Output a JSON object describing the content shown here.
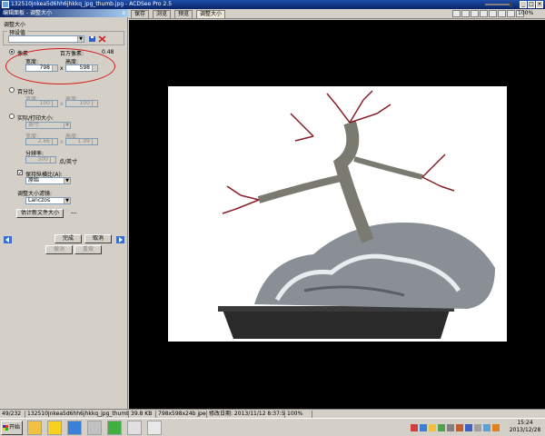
{
  "window": {
    "title": "132510jnkea5d6hh6jhkkq_jpg_thumb.jpg - ACDSee Pro 2.5"
  },
  "panel": {
    "header": "编辑面板 - 调整大小",
    "close_label": "x",
    "section_title": "调整大小",
    "preset": {
      "legend": "预设值",
      "value": ""
    },
    "pixels": {
      "radio_label": "像素",
      "megapixel_label": "百万像素:",
      "megapixel_value": "0.48",
      "width_label": "宽度:",
      "width_value": "798",
      "height_label": "高度:",
      "height_value": "598",
      "times": "x"
    },
    "percent": {
      "radio_label": "百分比",
      "width_label": "宽度:",
      "width_value": "100",
      "height_label": "高度:",
      "height_value": "100",
      "times": "x"
    },
    "actual": {
      "radio_label": "实际/打印大小:",
      "unit_value": "英寸",
      "width_label": "宽度:",
      "width_value": "2.66",
      "height_label": "高度:",
      "height_value": "1.99",
      "times": "x",
      "resolution_label": "分辨率:",
      "resolution_value": "300",
      "resolution_unit": "点/英寸"
    },
    "aspect": {
      "checkbox_label": "保持纵横比(A):",
      "checked": true,
      "value": "原始"
    },
    "filter": {
      "label": "调整大小滤镜:",
      "value": "Lanczos"
    },
    "estimate_button": "估计新文件大小",
    "estimate_value": "---",
    "done_button": "完成",
    "cancel_button": "取消",
    "undo_button": "撤消",
    "redo_button": "重做"
  },
  "tabs": [
    {
      "label": "保存"
    },
    {
      "label": "浏览"
    },
    {
      "label": "预览"
    },
    {
      "label": "调整大小",
      "active": true
    }
  ],
  "zoom": {
    "value": "100%",
    "level": 1.0
  },
  "statusbar": {
    "index": "49/232",
    "filename": "132510jnkea5d6hh6jhkkq_jpg_thumb.jpg",
    "filesize": "39.8 KB",
    "dimensions": "798x598x24b jpeg",
    "modified": "修改日期: 2013/11/12 8:37:50",
    "zoom": "100%"
  },
  "taskbar": {
    "start_label": "开始",
    "clock_time": "15:24",
    "clock_date": "2013/12/28"
  },
  "colors": {
    "title_bar": "#0a246a",
    "annotation_circle": "#d41a1a",
    "canvas_bg": "#000000"
  }
}
